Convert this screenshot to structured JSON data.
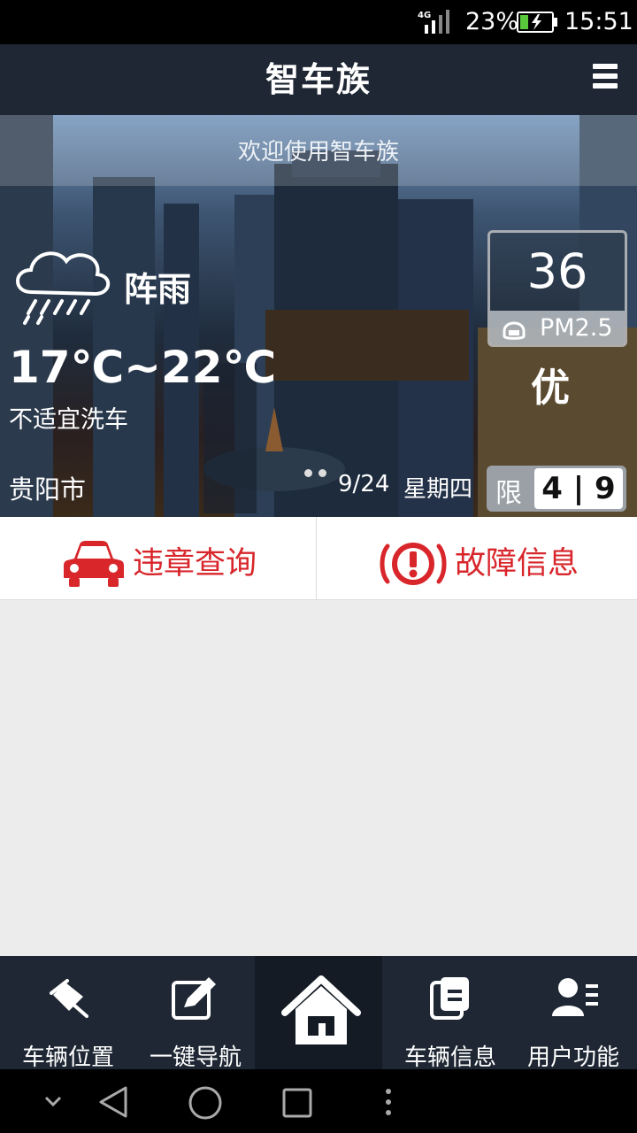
{
  "status_bar": {
    "network": "4G",
    "battery": "23%",
    "time": "15:51"
  },
  "app": {
    "title": "智车族"
  },
  "hero": {
    "welcome": "欢迎使用智车族",
    "weather": {
      "condition": "阵雨",
      "temperature": "17℃~22℃",
      "car_wash": "不适宜洗车",
      "icon": "rain-cloud-icon"
    },
    "air": {
      "value": "36",
      "label": "PM2.5",
      "quality": "优"
    },
    "city": "贵阳市",
    "date": "9/24",
    "weekday": "星期四",
    "restriction": {
      "label": "限",
      "numbers": "4 | 9"
    },
    "page_indicator": {
      "count": 2
    }
  },
  "actions": [
    {
      "label": "违章查询",
      "icon": "car-icon",
      "color": "#d8262b"
    },
    {
      "label": "故障信息",
      "icon": "warning-icon",
      "color": "#d8262b"
    }
  ],
  "bottom_nav": [
    {
      "label": "车辆位置",
      "icon": "pin-icon"
    },
    {
      "label": "一键导航",
      "icon": "edit-icon"
    },
    {
      "label": "",
      "icon": "home-icon"
    },
    {
      "label": "车辆信息",
      "icon": "document-icon"
    },
    {
      "label": "用户功能",
      "icon": "user-list-icon"
    }
  ]
}
